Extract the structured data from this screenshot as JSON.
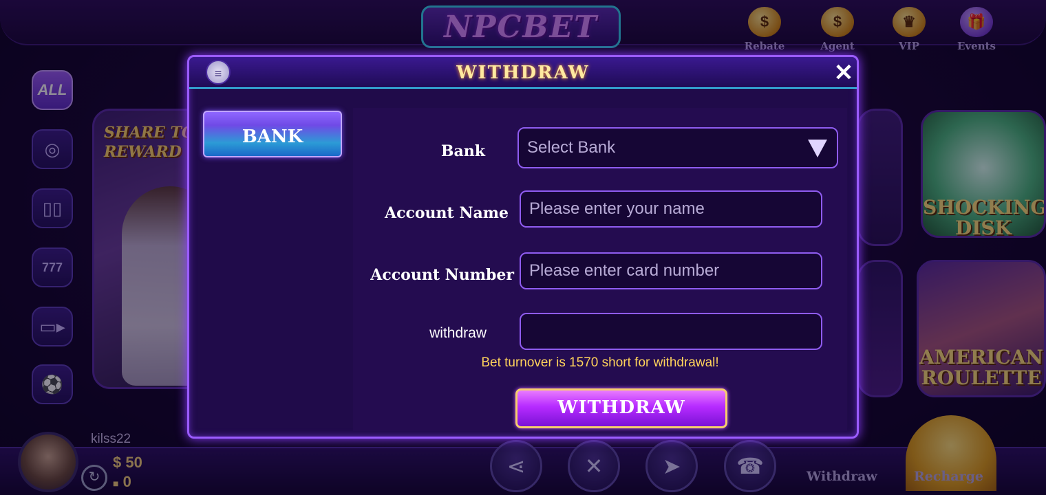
{
  "header": {
    "logo_text": "NPCBET",
    "items": [
      {
        "label": "Rebate",
        "icon": "rebate-icon"
      },
      {
        "label": "Agent",
        "icon": "agent-icon"
      },
      {
        "label": "VIP",
        "icon": "crown-icon"
      },
      {
        "label": "Events",
        "icon": "gift-icon"
      }
    ]
  },
  "sidebar": {
    "items": [
      {
        "label": "ALL"
      },
      {
        "icon": "chip-icon"
      },
      {
        "icon": "cards-icon"
      },
      {
        "icon": "slot-icon"
      },
      {
        "icon": "video-icon"
      },
      {
        "icon": "football-icon"
      }
    ]
  },
  "background_cards": {
    "left_title": "SHARE TO REWARD",
    "right_top_title": "SHOCKING DISK",
    "right_bottom_title": "AMERICAN ROULETTE"
  },
  "user": {
    "name": "kilss22",
    "balance_symbol": "$",
    "balance": "50",
    "chips": "0"
  },
  "bottom_nav": {
    "withdraw_label": "Withdraw",
    "recharge_label": "Recharge"
  },
  "modal": {
    "title": "WITHDRAW",
    "tab_label": "BANK",
    "bank_label": "Bank",
    "bank_placeholder": "Select Bank",
    "account_name_label": "Account Name",
    "account_name_placeholder": "Please enter your name",
    "account_number_label": "Account Number",
    "account_number_placeholder": "Please enter card number",
    "withdraw_amount_label": "withdraw",
    "withdraw_amount_value": "",
    "hint": "Bet turnover is 1570 short for withdrawal!",
    "submit_label": "WITHDRAW"
  },
  "colors": {
    "accent": "#9b5cff",
    "title_gold": "#ffe9a0",
    "hint_yellow": "#ffd35b",
    "cyan_line": "#37c6ee"
  }
}
